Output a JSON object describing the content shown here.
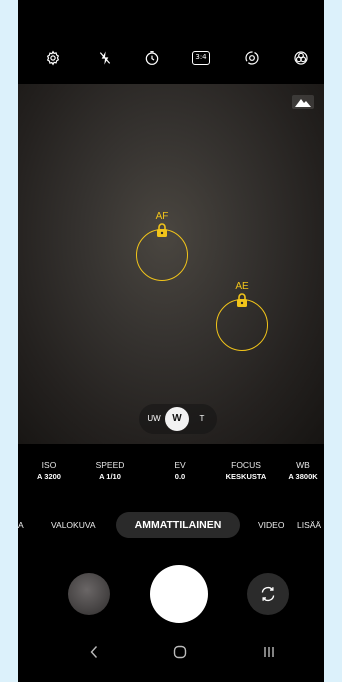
{
  "toolbar": {
    "settings_icon": "gear-icon",
    "flash_icon": "flash-off-icon",
    "timer_icon": "timer-icon",
    "ratio_label": "3:4",
    "motion_icon": "motion-photo-icon",
    "filter_icon": "filter-icon"
  },
  "viewfinder": {
    "scene_icon": "mountain-icon",
    "af": {
      "label": "AF",
      "icon": "lock-icon"
    },
    "ae": {
      "label": "AE",
      "icon": "lock-icon"
    },
    "zoom": {
      "options": [
        "UW",
        "W",
        "T"
      ],
      "selected": "W"
    }
  },
  "pro_settings": [
    {
      "label": "ISO",
      "value": "A 3200"
    },
    {
      "label": "SPEED",
      "value": "A 1/10"
    },
    {
      "label": "EV",
      "value": "0.0"
    },
    {
      "label": "FOCUS",
      "value": "KESKUSTA"
    },
    {
      "label": "WB",
      "value": "A 3800K"
    }
  ],
  "modes": {
    "left_partial": "A",
    "items": [
      "VALOKUVA",
      "AMMATTILAINEN",
      "VIDEO",
      "LISÄÄ"
    ],
    "selected": "AMMATTILAINEN"
  },
  "controls": {
    "gallery_icon": "gallery-thumbnail",
    "shutter_icon": "shutter-button",
    "switch_icon": "switch-camera-icon"
  },
  "navbar": {
    "back_icon": "back-icon",
    "home_icon": "home-icon",
    "recents_icon": "recents-icon"
  },
  "colors": {
    "lock_accent": "#f1c41a",
    "outer_background": "#dcf1fb"
  }
}
